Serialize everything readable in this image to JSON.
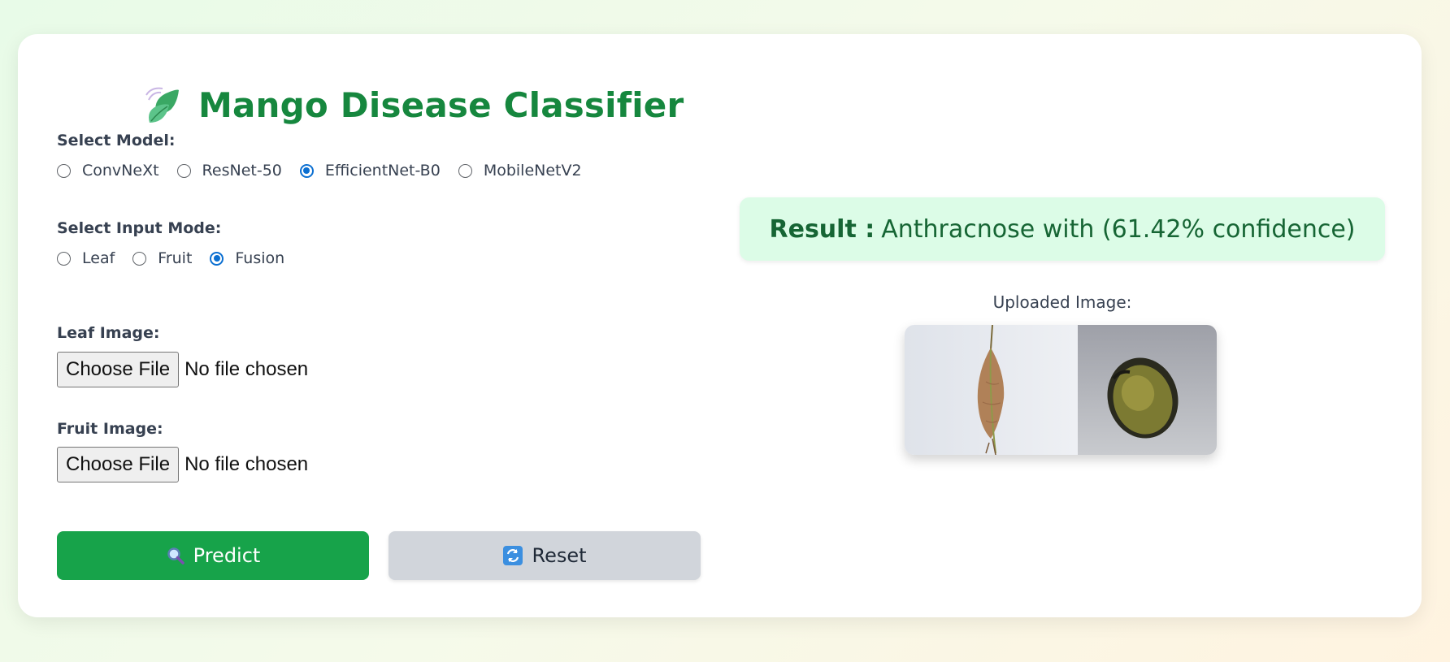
{
  "app": {
    "title": "Mango Disease Classifier",
    "logo_icon": "leaf-icon"
  },
  "model": {
    "label": "Select Model:",
    "options": [
      "ConvNeXt",
      "ResNet-50",
      "EfficientNet-B0",
      "MobileNetV2"
    ],
    "selected": "EfficientNet-B0"
  },
  "input_mode": {
    "label": "Select Input Mode:",
    "options": [
      "Leaf",
      "Fruit",
      "Fusion"
    ],
    "selected": "Fusion"
  },
  "leaf_image": {
    "label": "Leaf Image:",
    "button": "Choose File",
    "status": "No file chosen"
  },
  "fruit_image": {
    "label": "Fruit Image:",
    "button": "Choose File",
    "status": "No file chosen"
  },
  "actions": {
    "predict_label": "Predict",
    "predict_icon": "magnifier-icon",
    "reset_label": "Reset",
    "reset_icon": "refresh-icon"
  },
  "result": {
    "prefix": "Result :",
    "text": "Anthracnose with (61.42% confidence)"
  },
  "uploaded": {
    "label": "Uploaded Image:"
  },
  "colors": {
    "accent_green": "#16873e",
    "predict_button": "#17a34a",
    "result_bg": "#dcfce7",
    "radio_checked": "#0b6fd1"
  }
}
